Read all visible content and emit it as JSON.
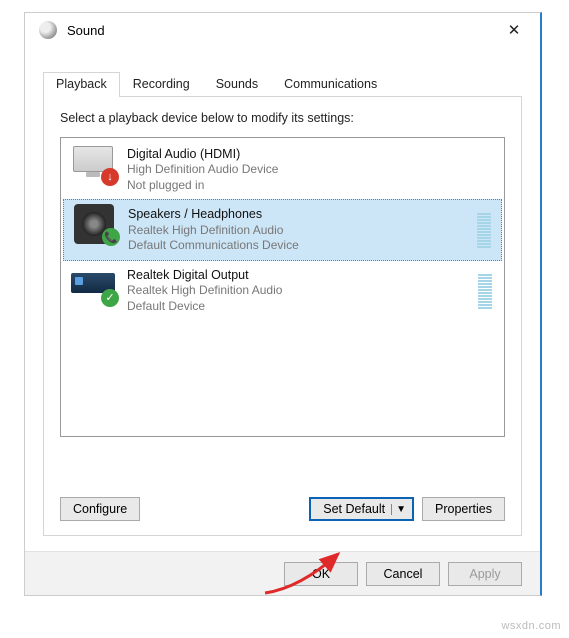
{
  "window": {
    "title": "Sound"
  },
  "tabs": [
    "Playback",
    "Recording",
    "Sounds",
    "Communications"
  ],
  "instruction": "Select a playback device below to modify its settings:",
  "devices": [
    {
      "name": "Digital Audio (HDMI)",
      "desc": "High Definition Audio Device",
      "status": "Not plugged in"
    },
    {
      "name": "Speakers / Headphones",
      "desc": "Realtek High Definition Audio",
      "status": "Default Communications Device"
    },
    {
      "name": "Realtek Digital Output",
      "desc": "Realtek High Definition Audio",
      "status": "Default Device"
    }
  ],
  "buttons": {
    "configure": "Configure",
    "set_default": "Set Default",
    "properties": "Properties",
    "ok": "OK",
    "cancel": "Cancel",
    "apply": "Apply"
  },
  "watermark": "wsxdn.com"
}
